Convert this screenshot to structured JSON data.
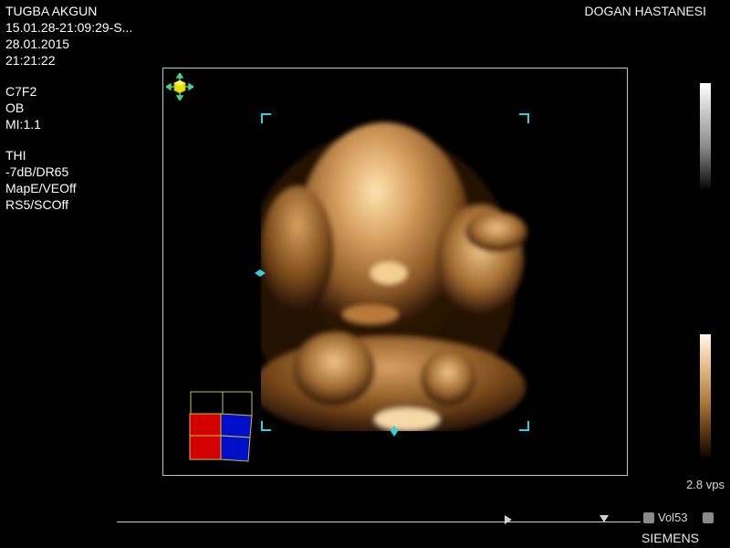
{
  "patient": {
    "name": "TUGBA AKGUN",
    "study_id": "15.01.28-21:09:29-S...",
    "date": "28.01.2015",
    "time": "21:21:22"
  },
  "hospital": "DOGAN HASTANESI",
  "params": {
    "transducer": "C7F2",
    "exam": "OB",
    "mi": "MI:1.1",
    "mode": "THI",
    "gain": "-7dB/DR65",
    "map": "MapE/VEOff",
    "rs": "RS5/SCOff"
  },
  "status": {
    "vps": "2.8 vps",
    "volume": "Vol53",
    "brand": "SIEMENS"
  },
  "icons": {
    "move": "move-arrows-icon",
    "prev": "volume-prev-icon",
    "next": "volume-next-icon"
  },
  "colors": {
    "roi_marker": "#2fd0e0",
    "frame": "#9fd4d4",
    "cube_red": "#d00000",
    "cube_blue": "#0010c0",
    "tissue": "#c8955a"
  }
}
